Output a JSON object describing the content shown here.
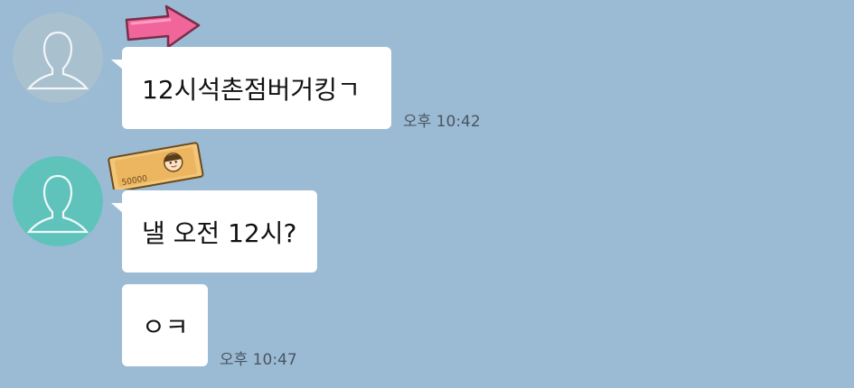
{
  "messages": [
    {
      "sender_avatar": "default-avatar-gray",
      "sticker": "pink-arrow-sticker",
      "text": "12시석촌점버거킹ㄱ",
      "time": "오후 10:42"
    },
    {
      "sender_avatar": "default-avatar-teal",
      "sticker": "banknote-50000-sticker",
      "banknote_value": "50000",
      "text": "낼 오전 12시?"
    },
    {
      "text": "ㅇㅋ",
      "time": "오후 10:47"
    }
  ],
  "colors": {
    "background": "#9bbbd4",
    "bubble": "#ffffff",
    "avatar_gray": "#a9c0cf",
    "avatar_teal": "#5fc3bc",
    "arrow": "#f0669b"
  }
}
